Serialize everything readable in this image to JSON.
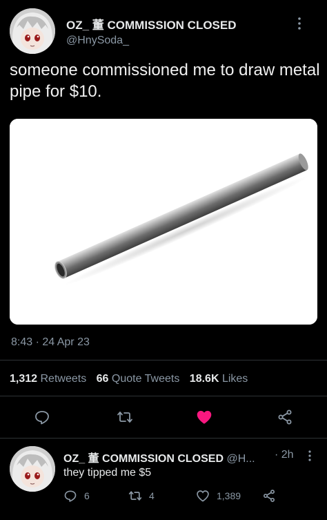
{
  "tweet": {
    "author_name": "OZ_ 董 COMMISSION CLOSED",
    "author_handle": "@HnySoda_",
    "text": "someone commissioned me to draw metal pipe for $10.",
    "timestamp": "8:43 · 24 Apr 23",
    "retweets_count": "1,312",
    "retweets_label": "Retweets",
    "quote_count": "66",
    "quote_label": "Quote Tweets",
    "likes_count": "18.6K",
    "likes_label": "Likes",
    "liked": true
  },
  "reply": {
    "author_name": "OZ_ 董 COMMISSION CLOSED",
    "author_handle": "@H...",
    "time": "· 2h",
    "text": "they tipped me $5",
    "reply_count": "6",
    "retweet_count": "4",
    "like_count": "1,389"
  },
  "icons": {
    "reply": "comment-icon",
    "retweet": "retweet-icon",
    "like": "heart-icon",
    "share": "share-icon",
    "more": "more-vertical-icon"
  },
  "colors": {
    "background": "#000000",
    "text": "#e7e9ea",
    "secondary": "#8b98a5",
    "like_active": "#f91880"
  }
}
